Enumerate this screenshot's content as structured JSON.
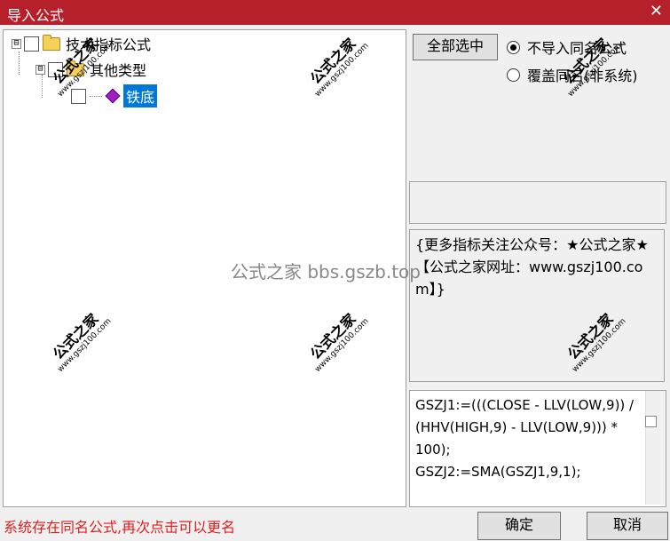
{
  "window": {
    "title": "导入公式",
    "close_glyph": "✕"
  },
  "tree": {
    "expanders": [
      "⊟",
      "⊟"
    ],
    "root_label": "技术指标公式",
    "group_label": "其他类型",
    "leaf_label": "铁底"
  },
  "buttons": {
    "select_all": "全部选中",
    "ok": "确定",
    "cancel": "取消"
  },
  "options": {
    "skip_same_name": "不导入同名公式",
    "overwrite_same_name": "覆盖同名(非系统)",
    "selected": "skip_same_name"
  },
  "description": "{更多指标关注公众号：★公式之家★ 【公式之家网址：www.gszj100.com】}",
  "code": "GSZJ1:=(((CLOSE - LLV(LOW,9)) / (HHV(HIGH,9) - LLV(LOW,9))) * 100);\nGSZJ2:=SMA(GSZJ1,9,1);",
  "status": "系统存在同名公式,再次点击可以更名",
  "watermark": {
    "main": "公式之家",
    "url": "www.gszj100.com",
    "center": "公式之家 bbs.gszb.top"
  },
  "colors": {
    "titlebar": "#b5202a",
    "selection": "#0078d7",
    "status_text": "#e02020"
  }
}
